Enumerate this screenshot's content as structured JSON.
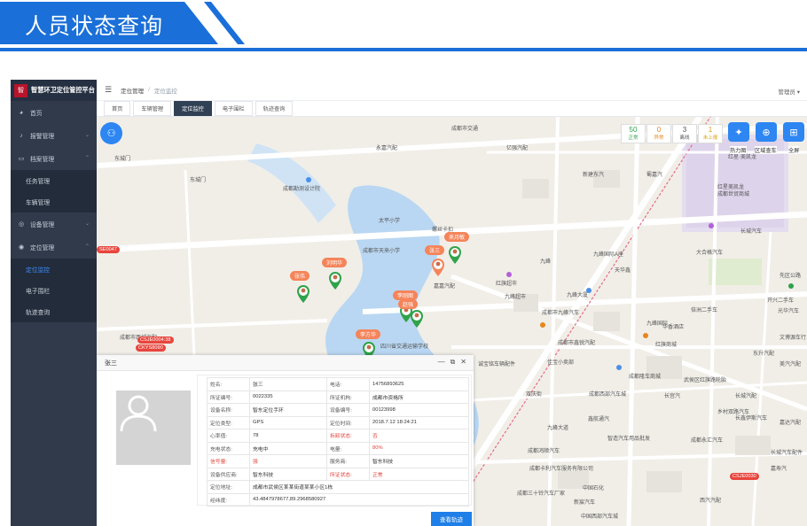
{
  "banner": {
    "title": "人员状态查询"
  },
  "app": {
    "logo_text": "智",
    "title": "智慧环卫定位管控平台"
  },
  "sidebar": {
    "items": [
      {
        "label": "首页",
        "icon": "palette-icon",
        "chevron": ""
      },
      {
        "label": "报警管理",
        "icon": "bell-icon",
        "chevron": "⌄"
      },
      {
        "label": "档案管理",
        "icon": "folder-icon",
        "chevron": "⌃"
      },
      {
        "label": "任务管理",
        "sub": true
      },
      {
        "label": "车辆管理",
        "sub": true
      },
      {
        "label": "设备管理",
        "icon": "device-icon",
        "chevron": "⌄"
      },
      {
        "label": "定位管理",
        "icon": "location-icon",
        "chevron": "⌃"
      },
      {
        "label": "定位监控",
        "sub": true,
        "active": true
      },
      {
        "label": "电子围栏",
        "sub": true
      },
      {
        "label": "轨迹查询",
        "sub": true
      }
    ]
  },
  "topbar": {
    "crumb_root": "定位管理",
    "crumb_sep": "/",
    "crumb_current": "定位监控",
    "user": "管理员 ▾"
  },
  "tabs": [
    "首页",
    "车辆管理",
    "定位监控",
    "电子围栏",
    "轨迹查询"
  ],
  "stats": [
    {
      "num": "50",
      "label": "正常",
      "color": "#2fa24a"
    },
    {
      "num": "0",
      "label": "异常",
      "color": "#e6861c"
    },
    {
      "num": "3",
      "label": "离线",
      "color": "#555555"
    },
    {
      "num": "1",
      "label": "未上报",
      "color": "#d8a20c"
    }
  ],
  "tools": [
    {
      "label": "热力图",
      "icon": "china-map-icon"
    },
    {
      "label": "区域查车",
      "icon": "zoom-area-icon"
    },
    {
      "label": "全屏",
      "icon": "grid-icon"
    }
  ],
  "map_labels": [
    "东城门",
    "东城门",
    "永嘉汽配",
    "成都市交通",
    "亿强汽配",
    "新建东汽",
    "蜀嘉汽",
    "红星·美凯龙",
    "红星美凯龙",
    "成都世贸商城",
    "长城汽车",
    "大合格汽车",
    "成都勘测设计院",
    "太平小学",
    "螺丝卡扣",
    "成都市天来小学",
    "嘉嘉汽配",
    "九峰国际A座",
    "九峰",
    "九峰大厦",
    "成都市九峰汽车",
    "倍洲二手车",
    "九峰国际",
    "红旗超市",
    "成都市西城汽配",
    "成都西部汽车城",
    "成都市鑫锐汽配",
    "四川省交通运输学校",
    "中国石化",
    "开兴二手车",
    "诚宝铭车辆配件",
    "佳宝小卖部",
    "华香酒店",
    "成都隆车商城",
    "武侯区红旗路轮胎",
    "成都鸿顺汽车",
    "长鑫伊斯汽车",
    "智造汽车用品批发",
    "成都永汇汽车",
    "嘉寿汽",
    "西汽汽配",
    "长城汽配",
    "成都卡利汽车服务有限公司",
    "成都三十铃汽车厂家",
    "新宸汽车",
    "长城汽车配件",
    "九峰超市",
    "东升汽配",
    "中国西部汽车城",
    "美汽汽配",
    "先区公路",
    "乡村双路汽车",
    "嘉达汽配",
    "红旗商城",
    "双庆街",
    "鑫航通汽",
    "长宫汽",
    "光华汽车",
    "文博源车行",
    "九峰大道",
    "天华鑫"
  ],
  "persons": [
    {
      "name": "来月敏"
    },
    {
      "name": "张三"
    },
    {
      "name": "刘明华"
    },
    {
      "name": "张伟"
    },
    {
      "name": "李刚图"
    },
    {
      "name": "赵强"
    },
    {
      "name": "李方华"
    }
  ],
  "vehicles": [
    "CSJE0004:38",
    "CKYS8090",
    "CSJE0030",
    "SE0047"
  ],
  "panel": {
    "name": "张三",
    "rows": [
      [
        "姓名:",
        "张三",
        "电话:",
        "14756893625"
      ],
      [
        "所证编号:",
        "0022335",
        "所证机构:",
        "成都市资格所"
      ],
      [
        "设备名称:",
        "智东定位手环",
        "设备编号:",
        "00123998"
      ],
      [
        "定位类型:",
        "GPS",
        "定位时间:",
        "2018.7.12 18:24:21"
      ],
      [
        "心率值:",
        "78",
        "拆卸状态:",
        "否"
      ],
      [
        "充电状态:",
        "充电中",
        "电量:",
        "80%"
      ],
      [
        "信号量:",
        "强",
        "服务商:",
        "智东科技"
      ],
      [
        "设备供应商:",
        "智东科技",
        "所证状态:",
        "正常"
      ],
      [
        "定位地址:",
        "成都市武侯区某某街道某某小区1栋",
        "",
        ""
      ],
      [
        "经纬度:",
        "43.4847978677,89.2968580927",
        "",
        ""
      ]
    ],
    "button": "查看轨迹"
  }
}
